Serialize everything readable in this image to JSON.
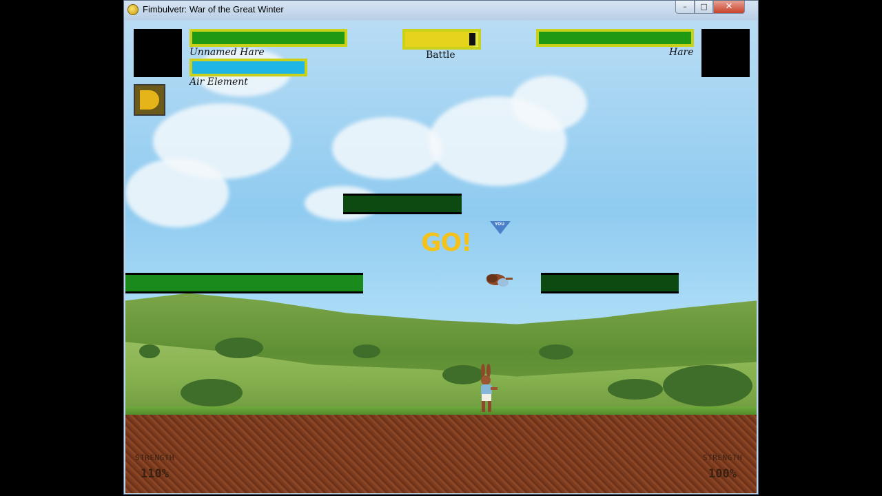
{
  "window": {
    "title": "Fimbulvetr: War of the Great Winter",
    "minimize_glyph": "–",
    "maximize_glyph": "□",
    "close_glyph": "✕"
  },
  "hud": {
    "player": {
      "name": "Unnamed Hare",
      "health_fraction": 1.0,
      "element_label": "Air Element",
      "element_fraction": 1.0,
      "strength_label": "STRENGTH",
      "strength_value": "110%"
    },
    "mode": {
      "label": "Battle",
      "timer_fraction": 0.93
    },
    "opponent": {
      "name": "Hare",
      "health_fraction": 1.0,
      "strength_label": "STRENGTH",
      "strength_value": "100%"
    }
  },
  "arena": {
    "announcement": "GO!",
    "you_marker": "YOU"
  },
  "colors": {
    "health": "#1f9a12",
    "element": "#1fb6e6",
    "timer": "#e6d31c",
    "bar_frame": "#c9d11b",
    "platform_dark": "#0d4a12",
    "platform_green": "#1b8a1d",
    "go_text": "#f4c21b",
    "you_marker": "#4a80c8"
  },
  "icons": {
    "app": "pygame-snake-icon",
    "ability": "air-ability-icon"
  }
}
